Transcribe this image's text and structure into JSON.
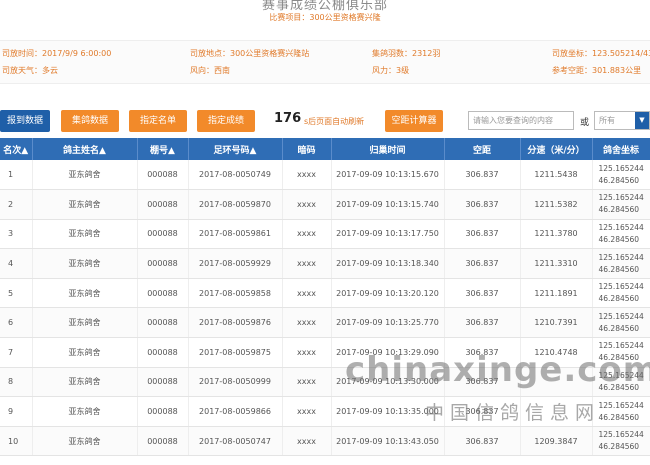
{
  "header": {
    "club_title": "赛事成绩公棚俱乐部",
    "subtitle": "比赛项目：300公里资格赛兴隆"
  },
  "info": {
    "release_time_label": "司放时间：",
    "release_time": "2017/9/9 6:00:00",
    "release_place_label": "司放地点：",
    "release_place": "300公里资格赛兴隆站",
    "count_label": "集鸽羽数：",
    "count": "2312羽",
    "coord_label": "司放坐标：",
    "coord": "123.505214/43.5",
    "weather_label": "司放天气：",
    "weather": "多云",
    "wind_dir_label": "风向：",
    "wind_dir": "西南",
    "wind_force_label": "风力：",
    "wind_force": "3级",
    "ref_dist_label": "参考空距：",
    "ref_dist": "301.883公里"
  },
  "toolbar": {
    "report_btn": "报到数据",
    "collect_btn": "集鸽数据",
    "list_btn": "指定名单",
    "results_btn": "指定成绩",
    "refresh_seconds": "176",
    "refresh_text": "s后页面自动刷新",
    "calc_btn": "空距计算器",
    "search_placeholder": "请输入您要查询的内容",
    "or_label": "或",
    "select_value": "所有",
    "select_arrow": "▼"
  },
  "table": {
    "columns": [
      "名次",
      "鸽主姓名",
      "棚号",
      "足环号码",
      "暗码",
      "归巢时间",
      "空距",
      "分速（米/分）",
      "鸽舍坐标"
    ],
    "sort_icon": "▲",
    "rows": [
      {
        "rank": "1",
        "owner": "亚东鸽舍",
        "loft": "000088",
        "ring": "2017-08-0050749",
        "code": "xxxx",
        "time": "2017-09-09 10:13:15.670",
        "dist": "306.837",
        "speed": "1211.5438",
        "coord1": "125.165244",
        "coord2": "46.284560"
      },
      {
        "rank": "2",
        "owner": "亚东鸽舍",
        "loft": "000088",
        "ring": "2017-08-0059870",
        "code": "xxxx",
        "time": "2017-09-09 10:13:15.740",
        "dist": "306.837",
        "speed": "1211.5382",
        "coord1": "125.165244",
        "coord2": "46.284560"
      },
      {
        "rank": "3",
        "owner": "亚东鸽舍",
        "loft": "000088",
        "ring": "2017-08-0059861",
        "code": "xxxx",
        "time": "2017-09-09 10:13:17.750",
        "dist": "306.837",
        "speed": "1211.3780",
        "coord1": "125.165244",
        "coord2": "46.284560"
      },
      {
        "rank": "4",
        "owner": "亚东鸽舍",
        "loft": "000088",
        "ring": "2017-08-0059929",
        "code": "xxxx",
        "time": "2017-09-09 10:13:18.340",
        "dist": "306.837",
        "speed": "1211.3310",
        "coord1": "125.165244",
        "coord2": "46.284560"
      },
      {
        "rank": "5",
        "owner": "亚东鸽舍",
        "loft": "000088",
        "ring": "2017-08-0059858",
        "code": "xxxx",
        "time": "2017-09-09 10:13:20.120",
        "dist": "306.837",
        "speed": "1211.1891",
        "coord1": "125.165244",
        "coord2": "46.284560"
      },
      {
        "rank": "6",
        "owner": "亚东鸽舍",
        "loft": "000088",
        "ring": "2017-08-0059876",
        "code": "xxxx",
        "time": "2017-09-09 10:13:25.770",
        "dist": "306.837",
        "speed": "1210.7391",
        "coord1": "125.165244",
        "coord2": "46.284560"
      },
      {
        "rank": "7",
        "owner": "亚东鸽舍",
        "loft": "000088",
        "ring": "2017-08-0059875",
        "code": "xxxx",
        "time": "2017-09-09 10:13:29.090",
        "dist": "306.837",
        "speed": "1210.4748",
        "coord1": "125.165244",
        "coord2": "46.284560"
      },
      {
        "rank": "8",
        "owner": "亚东鸽舍",
        "loft": "000088",
        "ring": "2017-08-0050999",
        "code": "xxxx",
        "time": "2017-09-09 10:13:30.000",
        "dist": "306.837",
        "speed": "",
        "coord1": "125.165244",
        "coord2": "46.284560"
      },
      {
        "rank": "9",
        "owner": "亚东鸽舍",
        "loft": "000088",
        "ring": "2017-08-0059866",
        "code": "xxxx",
        "time": "2017-09-09 10:13:35.000",
        "dist": "306.837",
        "speed": "",
        "coord1": "125.165244",
        "coord2": "46.284560"
      },
      {
        "rank": "10",
        "owner": "亚东鸽舍",
        "loft": "000088",
        "ring": "2017-08-0050747",
        "code": "xxxx",
        "time": "2017-09-09 10:13:43.050",
        "dist": "306.837",
        "speed": "1209.3847",
        "coord1": "125.165244",
        "coord2": "46.284560"
      }
    ]
  },
  "watermark": {
    "latin": "chinaxinge.com",
    "chinese": "中国信鸽信息网"
  }
}
